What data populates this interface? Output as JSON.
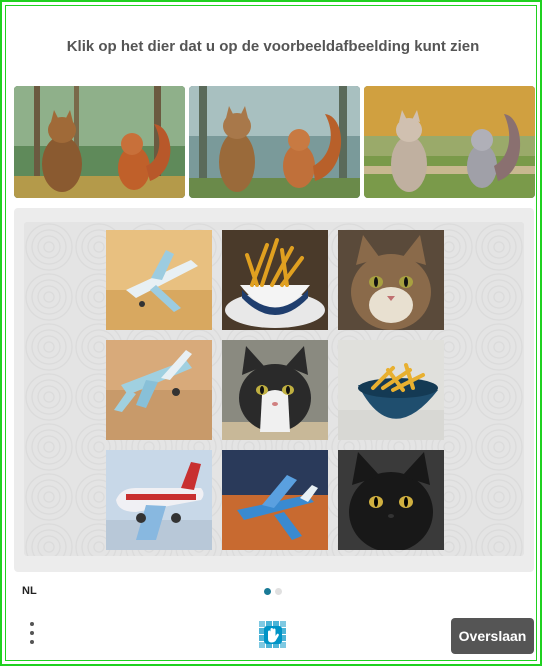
{
  "prompt": "Klik op het dier dat u op de voorbeeldafbeelding kunt zien",
  "examples": [
    {
      "icon": "cat-and-squirrel-forest-image"
    },
    {
      "icon": "cat-and-squirrel-forest-image"
    },
    {
      "icon": "cat-and-squirrel-park-image"
    }
  ],
  "tiles": [
    {
      "icon": "toy-airplane-image"
    },
    {
      "icon": "french-fries-image"
    },
    {
      "icon": "tabby-cat-image"
    },
    {
      "icon": "toy-airplane-image"
    },
    {
      "icon": "tuxedo-cat-image"
    },
    {
      "icon": "french-fries-image"
    },
    {
      "icon": "toy-airplane-image"
    },
    {
      "icon": "toy-airplane-image"
    },
    {
      "icon": "black-cat-image"
    }
  ],
  "footer": {
    "language": "NL",
    "skip_label": "Overslaan",
    "active_page": 1,
    "page_count": 2
  },
  "colors": {
    "frame_border": "#1fd11f",
    "prompt_text": "#555555",
    "skip_button": "#555555",
    "dot_active": "#1a7a96",
    "dot_inactive": "#e0e0e0",
    "logo": "#0094c6"
  }
}
